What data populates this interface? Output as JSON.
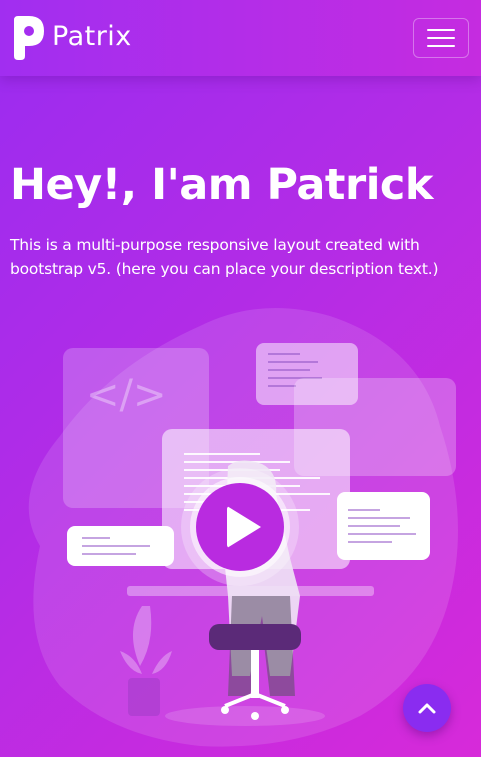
{
  "brand": {
    "name": "Patrix"
  },
  "hero": {
    "title": "Hey!, I'am Patrick",
    "description": "This is a multi-purpose responsive layout created with bootstrap v5. (here you can place your description text.)"
  },
  "icons": {
    "logo": "patrix-logo",
    "menu": "hamburger-menu-icon",
    "play": "play-icon",
    "back_to_top": "chevron-up-icon"
  },
  "colors": {
    "background_start": "#9a2cf0",
    "background_end": "#d72ad9",
    "play_button": "#b92be0",
    "back_to_top": "#8a2cf0"
  }
}
